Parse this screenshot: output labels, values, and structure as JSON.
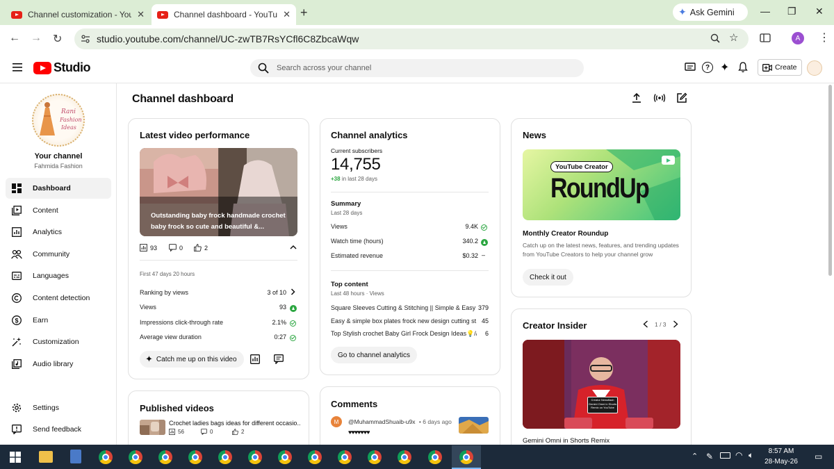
{
  "browser": {
    "tabs": [
      {
        "title": "Channel customization - YouTube"
      },
      {
        "title": "Channel dashboard - YouTube Studio"
      }
    ],
    "ask_gemini": "Ask Gemini",
    "url": "studio.youtube.com/channel/UC-zwTB7RsYCfl6C8ZbcaWqw",
    "profile_initial": "A"
  },
  "header": {
    "logo_text": "Studio",
    "search_placeholder": "Search across your channel",
    "create_label": "Create"
  },
  "sidebar": {
    "logo_text": "Rani Fashion Ideas",
    "your_channel": "Your channel",
    "channel_name": "Fahmida Fashion",
    "items": [
      {
        "label": "Dashboard",
        "icon": "dashboard-icon"
      },
      {
        "label": "Content",
        "icon": "content-icon"
      },
      {
        "label": "Analytics",
        "icon": "analytics-icon"
      },
      {
        "label": "Community",
        "icon": "community-icon"
      },
      {
        "label": "Languages",
        "icon": "languages-icon"
      },
      {
        "label": "Content detection",
        "icon": "copyright-icon"
      },
      {
        "label": "Earn",
        "icon": "earn-icon"
      },
      {
        "label": "Customization",
        "icon": "magic-wand-icon"
      },
      {
        "label": "Audio library",
        "icon": "audio-library-icon"
      }
    ],
    "settings": "Settings",
    "feedback": "Send feedback"
  },
  "main": {
    "title": "Channel dashboard",
    "latest": {
      "heading": "Latest video performance",
      "thumb_title": "Outstanding baby frock handmade crochet baby frock so cute and beautiful &...",
      "views": "93",
      "comments": "0",
      "likes": "2",
      "period": "First 47 days 20 hours",
      "rows": [
        {
          "label": "Ranking by views",
          "value": "3 of 10"
        },
        {
          "label": "Views",
          "value": "93"
        },
        {
          "label": "Impressions click-through rate",
          "value": "2.1%"
        },
        {
          "label": "Average view duration",
          "value": "0:27"
        }
      ],
      "catch_me_up": "Catch me up on this video"
    },
    "published": {
      "heading": "Published videos",
      "item_title": "Crochet ladies bags ideas for different occasio...",
      "views": "56",
      "comments": "0",
      "likes": "2"
    },
    "analytics": {
      "heading": "Channel analytics",
      "subs_label": "Current subscribers",
      "subs_value": "14,755",
      "subs_delta": "+38",
      "subs_delta_suffix": "in last 28 days",
      "summary_label": "Summary",
      "summary_period": "Last 28 days",
      "summary_rows": [
        {
          "label": "Views",
          "value": "9.4K"
        },
        {
          "label": "Watch time (hours)",
          "value": "340.2"
        },
        {
          "label": "Estimated revenue",
          "value": "$0.32"
        }
      ],
      "top_label": "Top content",
      "top_period": "Last 48 hours · Views",
      "top_rows": [
        {
          "label": "Square Sleeves Cutting & Stitching || Simple & Easy A...",
          "value": "379"
        },
        {
          "label": "Easy & simple box plates frock new design cutting st...",
          "value": "45"
        },
        {
          "label": "Top Stylish crochet Baby Girl Frock Design Ideas💡//...",
          "value": "6"
        }
      ],
      "goto": "Go to channel analytics"
    },
    "comments": {
      "heading": "Comments",
      "author": "@MuhammadShuaib-u9x",
      "time": "• 6 days ago",
      "text": "♥♥♥♥♥♥♥",
      "avatar_initial": "M"
    },
    "news": {
      "heading": "News",
      "badge": "YouTube Creator",
      "banner_title": "RoundUp",
      "item_title": "Monthly Creator Roundup",
      "item_desc": "Catch up on the latest news, features, and trending updates from YouTube Creators to help your channel grow",
      "cta": "Check it out"
    },
    "insider": {
      "heading": "Creator Insider",
      "pager": "1 / 3",
      "sign_text": "Creator Newsflash Gemini Omni in Shorts Remix on YouTube",
      "video_title": "Gemini Omni in Shorts Remix"
    }
  },
  "taskbar": {
    "time": "8:57 AM",
    "date": "28-May-26"
  },
  "colors": {
    "accent_red": "#ff0000",
    "tab_strip": "#dcedd5",
    "success_green": "#2ba640",
    "taskbar": "#1c2a3a"
  }
}
